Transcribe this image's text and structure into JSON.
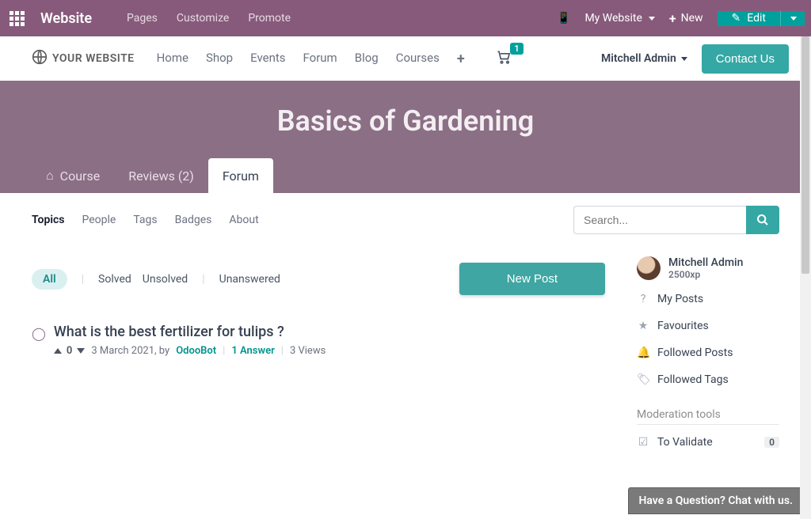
{
  "admin": {
    "brand": "Website",
    "menu": [
      "Pages",
      "Customize",
      "Promote"
    ],
    "my_website": "My Website",
    "new_label": "New",
    "edit_label": "Edit"
  },
  "site": {
    "logo_text": "YOUR WEBSITE",
    "menu": [
      "Home",
      "Shop",
      "Events",
      "Forum",
      "Blog",
      "Courses"
    ],
    "cart_count": "1",
    "user": "Mitchell Admin",
    "contact_label": "Contact Us"
  },
  "hero": {
    "title": "Basics of Gardening",
    "tabs": {
      "course": "Course",
      "reviews": "Reviews (2)",
      "forum": "Forum"
    }
  },
  "subtabs": [
    "Topics",
    "People",
    "Tags",
    "Badges",
    "About"
  ],
  "search": {
    "placeholder": "Search..."
  },
  "filters": {
    "all": "All",
    "solved": "Solved",
    "unsolved": "Unsolved",
    "unanswered": "Unanswered"
  },
  "new_post": "New Post",
  "post": {
    "title": "What is the best fertilizer for tulips ?",
    "votes": "0",
    "date": "3 March 2021",
    "by": "by",
    "author": "OdooBot",
    "answers": "1 Answer",
    "views": "3 Views"
  },
  "sidebar": {
    "user_name": "Mitchell Admin",
    "xp": "2500xp",
    "links": {
      "my_posts": "My Posts",
      "favourites": "Favourites",
      "followed_posts": "Followed Posts",
      "followed_tags": "Followed Tags"
    },
    "moderation_title": "Moderation tools",
    "to_validate": "To Validate",
    "to_validate_count": "0"
  },
  "chat": "Have a Question? Chat with us."
}
